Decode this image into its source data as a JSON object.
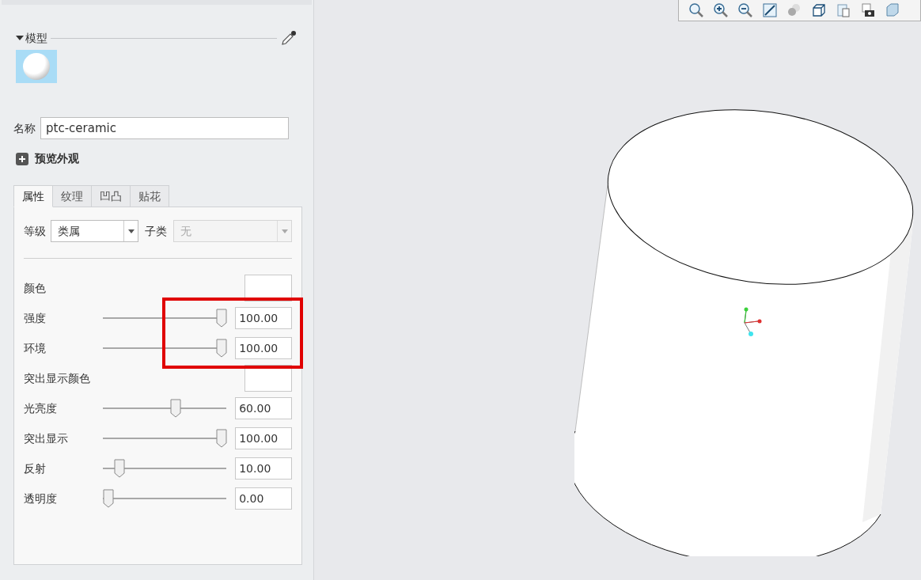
{
  "model_section": {
    "title": "模型",
    "expanded": true
  },
  "name_field": {
    "label": "名称",
    "value": "ptc-ceramic"
  },
  "preview": {
    "label": "预览外观",
    "expanded": false
  },
  "tabs": [
    {
      "label": "属性",
      "selected": true
    },
    {
      "label": "纹理",
      "selected": false
    },
    {
      "label": "凹凸",
      "selected": false
    },
    {
      "label": "贴花",
      "selected": false
    }
  ],
  "class_row": {
    "label": "等级",
    "value": "类属",
    "sub_label": "子类",
    "sub_value": "无",
    "sub_disabled": true
  },
  "properties": [
    {
      "kind": "color",
      "label": "颜色",
      "color": "#ffffff"
    },
    {
      "kind": "slider",
      "label": "强度",
      "level": 1,
      "value": "100.00"
    },
    {
      "kind": "slider",
      "label": "环境",
      "level": 1,
      "value": "100.00"
    },
    {
      "kind": "color",
      "label": "突出显示颜色",
      "color": "#ffffff"
    },
    {
      "kind": "slider",
      "label": "光亮度",
      "level": 0.6,
      "value": "60.00"
    },
    {
      "kind": "slider",
      "label": "突出显示",
      "level": 1,
      "value": "100.00"
    },
    {
      "kind": "slider",
      "label": "反射",
      "level": 0.1,
      "value": "10.00"
    },
    {
      "kind": "slider",
      "label": "透明度",
      "level": 0,
      "value": "0.00"
    }
  ]
}
